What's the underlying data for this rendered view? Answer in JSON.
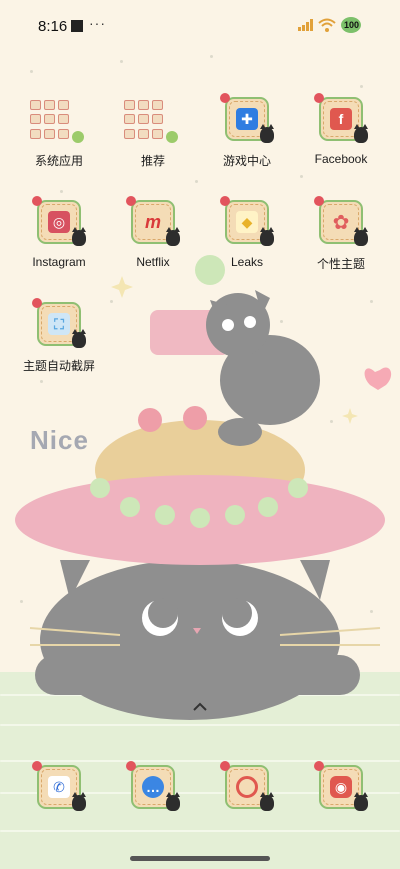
{
  "status_bar": {
    "time": "8:16",
    "dots": "···",
    "battery": "100"
  },
  "wallpaper": {
    "text": "Nice"
  },
  "apps": [
    {
      "label": "系统应用",
      "icon": "folder-icon",
      "type": "folder"
    },
    {
      "label": "推荐",
      "icon": "folder-icon",
      "type": "folder"
    },
    {
      "label": "游戏中心",
      "icon": "gamepad-icon",
      "color": "#2f7de1"
    },
    {
      "label": "Facebook",
      "icon": "facebook-icon",
      "color": "#e0584f",
      "glyph": "f"
    },
    {
      "label": "Instagram",
      "icon": "instagram-icon",
      "color": "#d75160"
    },
    {
      "label": "Netflix",
      "icon": "netflix-icon",
      "color": "#d93a3a",
      "glyph": "m"
    },
    {
      "label": "Leaks",
      "icon": "bird-icon",
      "color": "#f3c53a"
    },
    {
      "label": "个性主题",
      "icon": "flower-icon",
      "color": "#e05d5d"
    },
    {
      "label": "主题自动截屏",
      "icon": "screenshot-icon",
      "color": "#5aa7e0"
    }
  ],
  "dock": [
    {
      "icon": "phone-icon",
      "color": "#2f6bd6"
    },
    {
      "icon": "message-icon",
      "color": "#3b86e3"
    },
    {
      "icon": "browser-icon",
      "color": "#e0584f"
    },
    {
      "icon": "camera-icon",
      "color": "#e0584f"
    }
  ]
}
